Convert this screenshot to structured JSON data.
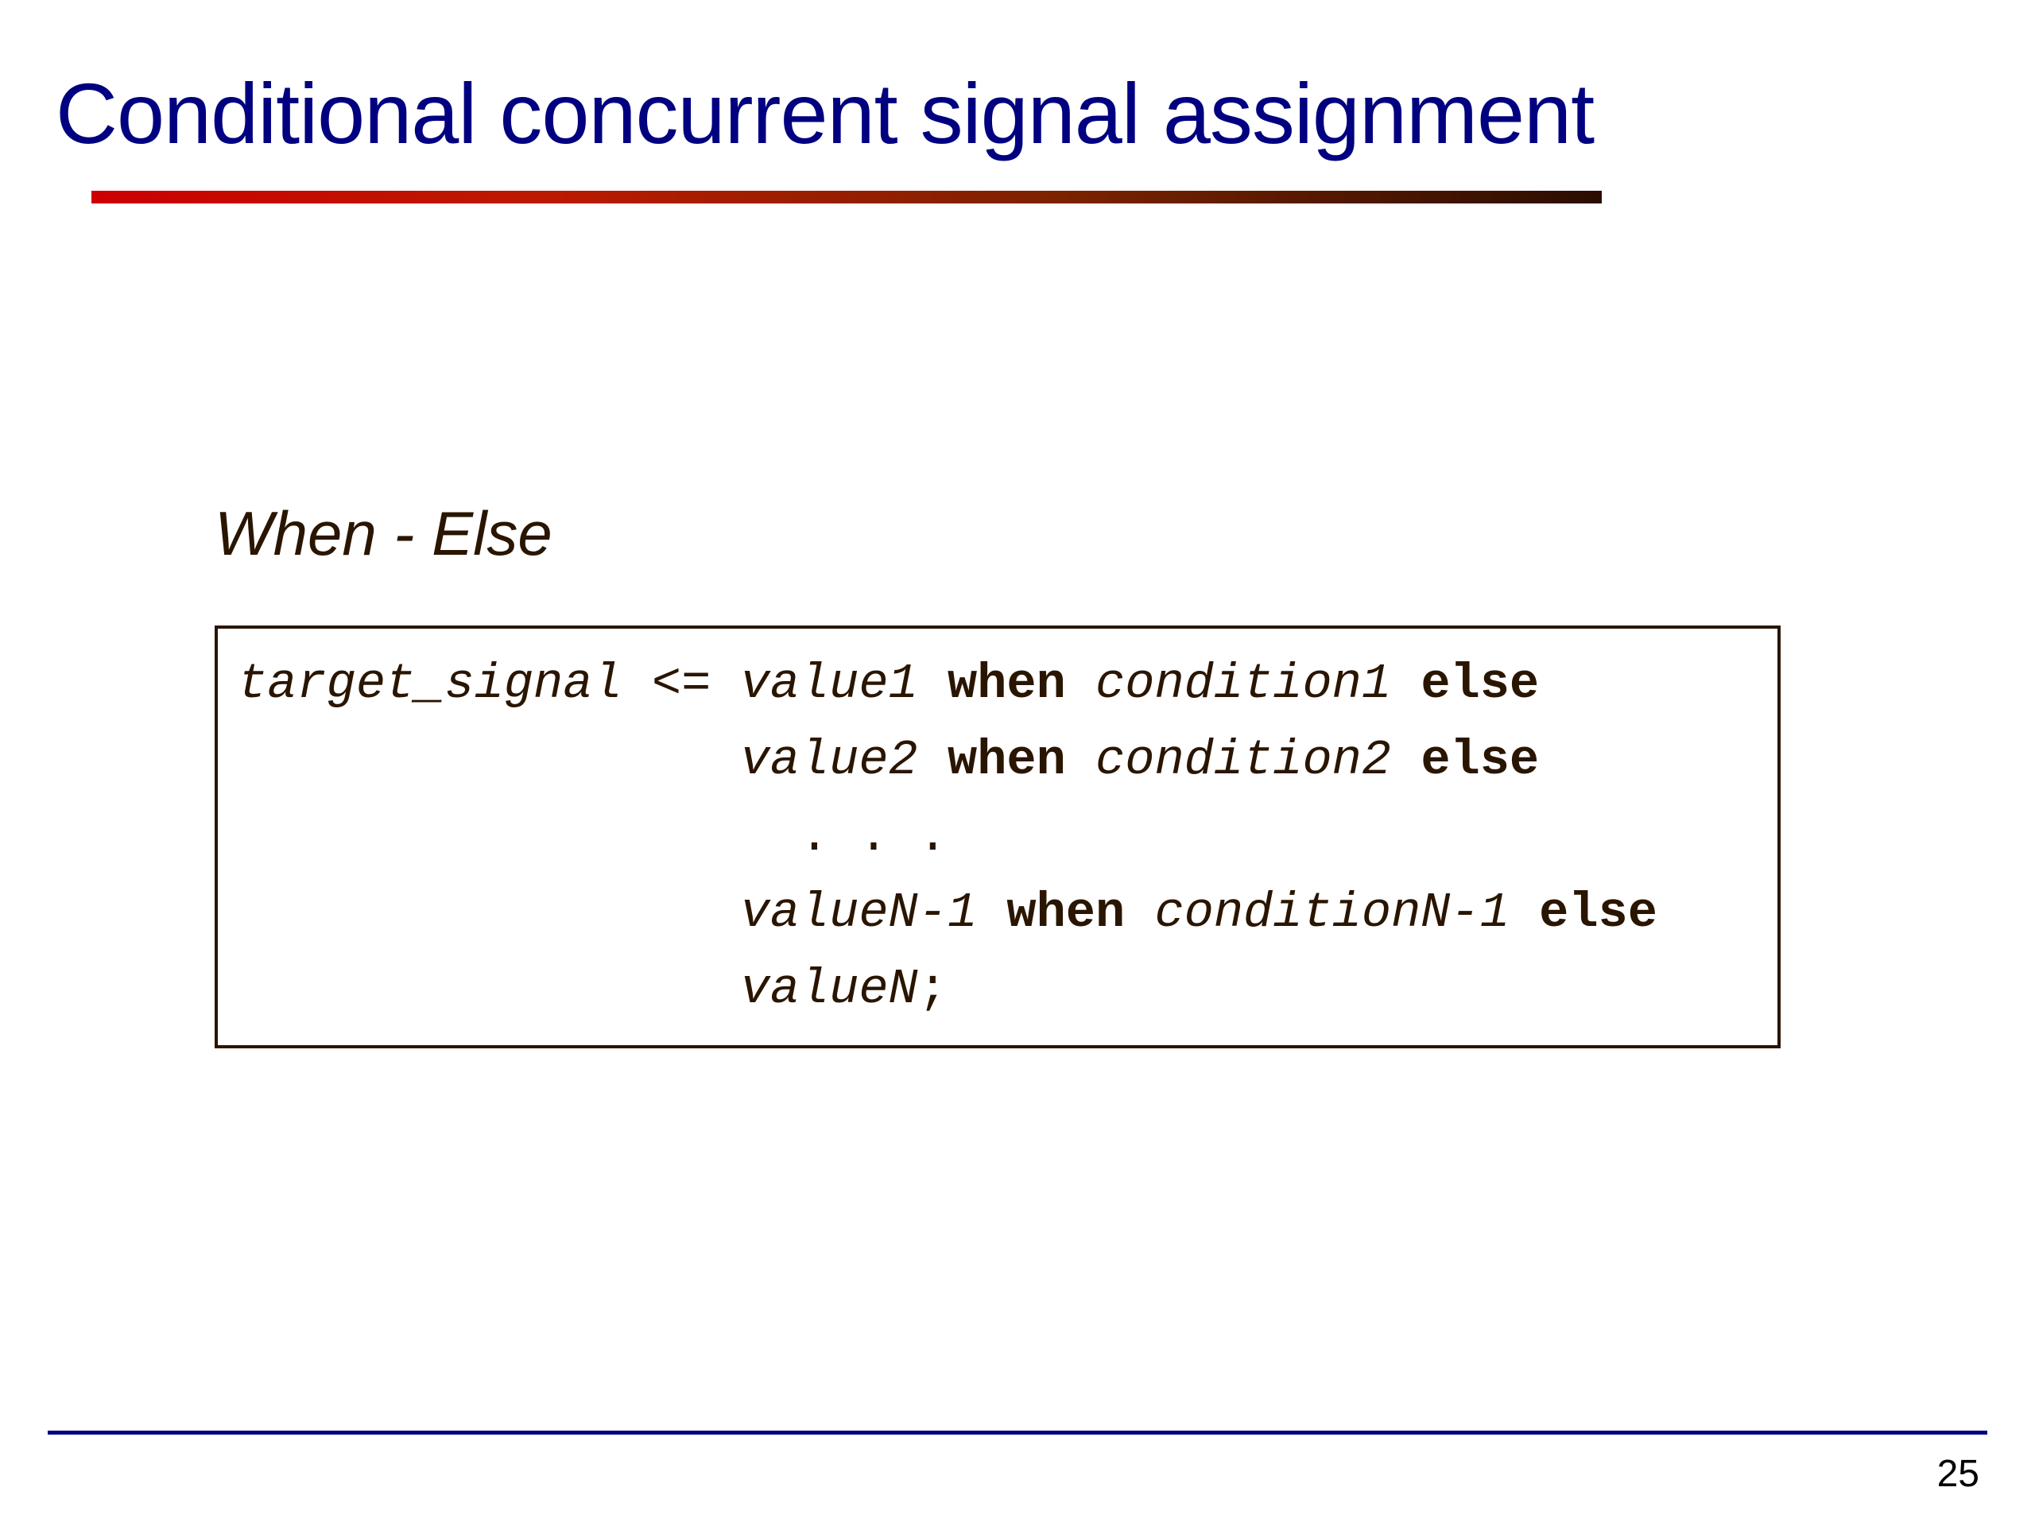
{
  "slide": {
    "title": "Conditional concurrent signal assignment",
    "subtitle": "When - Else",
    "page_number": "25"
  },
  "code": {
    "lines": [
      {
        "indent": "",
        "segments": [
          {
            "text": "target_signal",
            "style": "italic"
          },
          {
            "text": " <= ",
            "style": "italic"
          },
          {
            "text": "value1",
            "style": "italic"
          },
          {
            "text": " ",
            "style": "plain"
          },
          {
            "text": "when",
            "style": "keyword"
          },
          {
            "text": " ",
            "style": "plain"
          },
          {
            "text": "condition1",
            "style": "italic"
          },
          {
            "text": " ",
            "style": "plain"
          },
          {
            "text": "else",
            "style": "keyword"
          }
        ]
      },
      {
        "indent": "                 ",
        "segments": [
          {
            "text": "value2",
            "style": "italic"
          },
          {
            "text": " ",
            "style": "plain"
          },
          {
            "text": "when",
            "style": "keyword"
          },
          {
            "text": " ",
            "style": "plain"
          },
          {
            "text": "condition2",
            "style": "italic"
          },
          {
            "text": " ",
            "style": "plain"
          },
          {
            "text": "else",
            "style": "keyword"
          }
        ]
      },
      {
        "indent": "                   ",
        "segments": [
          {
            "text": ". . .",
            "style": "plain"
          }
        ]
      },
      {
        "indent": "                 ",
        "segments": [
          {
            "text": "valueN-1",
            "style": "italic"
          },
          {
            "text": " ",
            "style": "plain"
          },
          {
            "text": "when",
            "style": "keyword"
          },
          {
            "text": " ",
            "style": "plain"
          },
          {
            "text": "conditionN-1",
            "style": "italic"
          },
          {
            "text": " ",
            "style": "plain"
          },
          {
            "text": "else",
            "style": "keyword"
          }
        ]
      },
      {
        "indent": "                 ",
        "segments": [
          {
            "text": "valueN",
            "style": "italic"
          },
          {
            "text": ";",
            "style": "plain"
          }
        ]
      }
    ]
  }
}
